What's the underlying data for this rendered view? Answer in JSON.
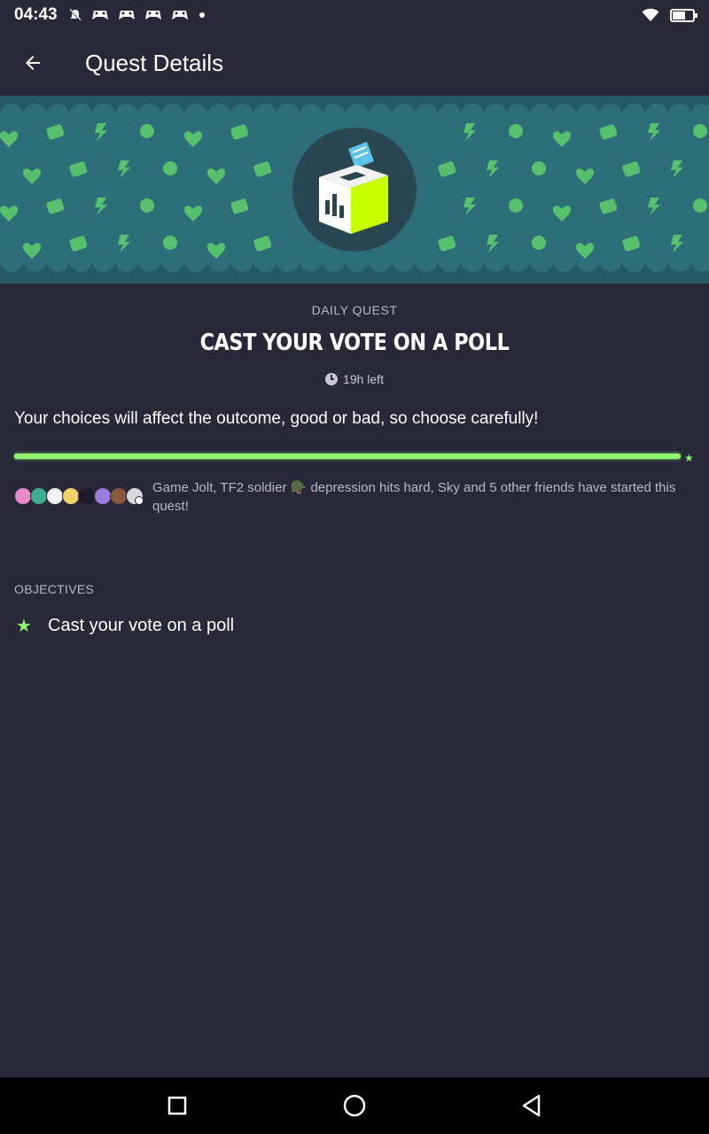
{
  "status_bar": {
    "time": "04:43",
    "icons": [
      "mute-bell-icon",
      "gamepad-icon",
      "gamepad-icon",
      "gamepad-icon",
      "gamepad-icon",
      "dot-icon"
    ],
    "right_icons": [
      "wifi-icon",
      "battery-icon"
    ]
  },
  "app_bar": {
    "title": "Quest Details",
    "back_icon": "arrow-left-icon"
  },
  "banner": {
    "icon": "ballot-box-icon",
    "background_color": "#2d6e79",
    "accent_color": "#c8ff00"
  },
  "quest": {
    "type_label": "DAILY QUEST",
    "title": "CAST YOUR VOTE ON A POLL",
    "time_left": "19h left",
    "description": "Your choices will affect the outcome, good or bad, so choose carefully!",
    "progress_percent": 100
  },
  "friends": {
    "text": "Game Jolt, TF2 soldier 🪖 depression hits hard, Sky and 5 other friends have started this quest!",
    "avatar_colors": [
      "#e889c9",
      "#3fae8c",
      "#f3f3f3",
      "#f2d36a",
      "#1b1b2a",
      "#9b7de0",
      "#8a5a3c",
      "#d9d9d9"
    ]
  },
  "objectives": {
    "label": "OBJECTIVES",
    "items": [
      {
        "icon": "star-icon",
        "text": "Cast your vote on a poll"
      }
    ]
  },
  "nav_bar": {
    "buttons": [
      "recents-square-icon",
      "home-circle-icon",
      "back-triangle-icon"
    ]
  },
  "colors": {
    "background": "#292839",
    "accent_green": "#8ef36d",
    "muted_text": "#b8b7c4"
  }
}
